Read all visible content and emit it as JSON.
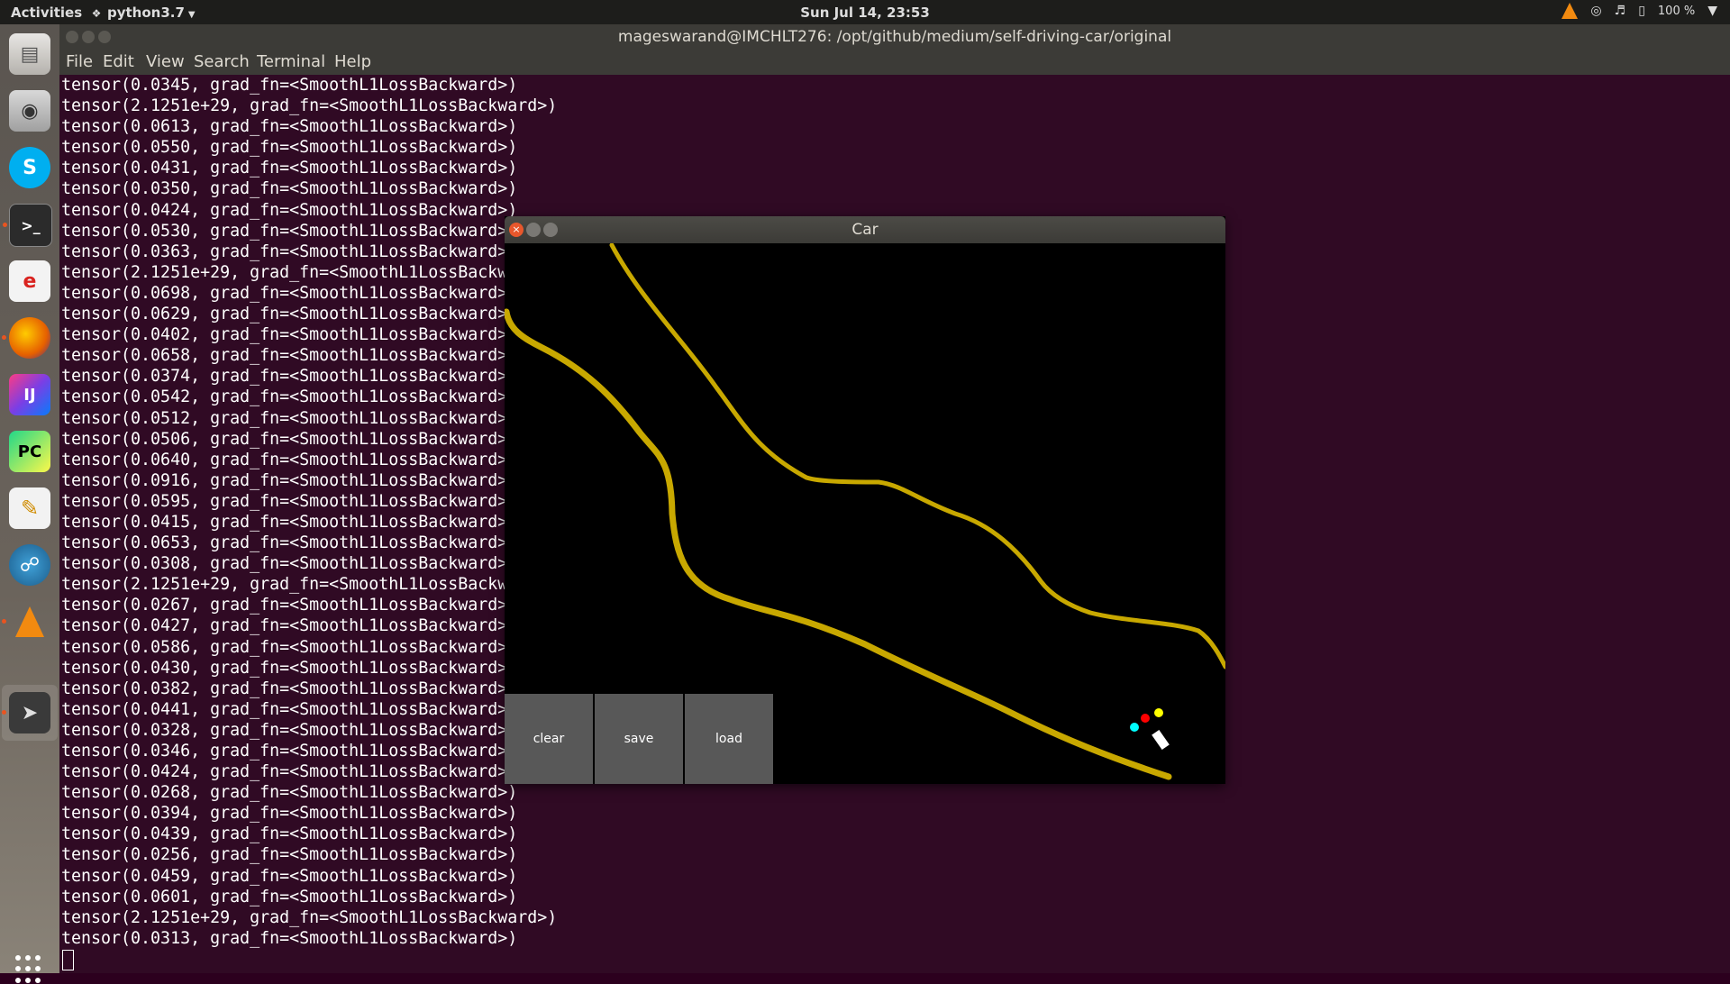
{
  "topbar": {
    "activities": "Activities",
    "app_menu": "python3.7",
    "clock": "Sun Jul 14, 23:53",
    "battery": "100 %"
  },
  "dock": {
    "items": [
      "files-icon",
      "screenshot-icon",
      "skype-icon",
      "terminal-icon",
      "ebook-reader-icon",
      "firefox-icon",
      "intellij-idea-icon",
      "pycharm-icon",
      "text-editor-icon",
      "network-globe-icon",
      "vlc-icon",
      "kivy-app-icon"
    ]
  },
  "terminal": {
    "title": "mageswarand@IMCHLT276: /opt/github/medium/self-driving-car/original",
    "menu": [
      "File",
      "Edit",
      "View",
      "Search",
      "Terminal",
      "Help"
    ],
    "lines": [
      "tensor(0.0345, grad_fn=<SmoothL1LossBackward>)",
      "tensor(2.1251e+29, grad_fn=<SmoothL1LossBackward>)",
      "tensor(0.0613, grad_fn=<SmoothL1LossBackward>)",
      "tensor(0.0550, grad_fn=<SmoothL1LossBackward>)",
      "tensor(0.0431, grad_fn=<SmoothL1LossBackward>)",
      "tensor(0.0350, grad_fn=<SmoothL1LossBackward>)",
      "tensor(0.0424, grad_fn=<SmoothL1LossBackward>)",
      "tensor(0.0530, grad_fn=<SmoothL1LossBackward>",
      "tensor(0.0363, grad_fn=<SmoothL1LossBackward>",
      "tensor(2.1251e+29, grad_fn=<SmoothL1LossBackw",
      "tensor(0.0698, grad_fn=<SmoothL1LossBackward>",
      "tensor(0.0629, grad_fn=<SmoothL1LossBackward>",
      "tensor(0.0402, grad_fn=<SmoothL1LossBackward>",
      "tensor(0.0658, grad_fn=<SmoothL1LossBackward>",
      "tensor(0.0374, grad_fn=<SmoothL1LossBackward>",
      "tensor(0.0542, grad_fn=<SmoothL1LossBackward>",
      "tensor(0.0512, grad_fn=<SmoothL1LossBackward>",
      "tensor(0.0506, grad_fn=<SmoothL1LossBackward>",
      "tensor(0.0640, grad_fn=<SmoothL1LossBackward>",
      "tensor(0.0916, grad_fn=<SmoothL1LossBackward>",
      "tensor(0.0595, grad_fn=<SmoothL1LossBackward>",
      "tensor(0.0415, grad_fn=<SmoothL1LossBackward>",
      "tensor(0.0653, grad_fn=<SmoothL1LossBackward>",
      "tensor(0.0308, grad_fn=<SmoothL1LossBackward>",
      "tensor(2.1251e+29, grad_fn=<SmoothL1LossBackw",
      "tensor(0.0267, grad_fn=<SmoothL1LossBackward>",
      "tensor(0.0427, grad_fn=<SmoothL1LossBackward>",
      "tensor(0.0586, grad_fn=<SmoothL1LossBackward>",
      "tensor(0.0430, grad_fn=<SmoothL1LossBackward>",
      "tensor(0.0382, grad_fn=<SmoothL1LossBackward>",
      "tensor(0.0441, grad_fn=<SmoothL1LossBackward>",
      "tensor(0.0328, grad_fn=<SmoothL1LossBackward>",
      "tensor(0.0346, grad_fn=<SmoothL1LossBackward>",
      "tensor(0.0424, grad_fn=<SmoothL1LossBackward>",
      "tensor(0.0268, grad_fn=<SmoothL1LossBackward>)",
      "tensor(0.0394, grad_fn=<SmoothL1LossBackward>)",
      "tensor(0.0439, grad_fn=<SmoothL1LossBackward>)",
      "tensor(0.0256, grad_fn=<SmoothL1LossBackward>)",
      "tensor(0.0459, grad_fn=<SmoothL1LossBackward>)",
      "tensor(0.0601, grad_fn=<SmoothL1LossBackward>)",
      "tensor(2.1251e+29, grad_fn=<SmoothL1LossBackward>)",
      "tensor(0.0313, grad_fn=<SmoothL1LossBackward>)"
    ]
  },
  "car_window": {
    "title": "Car",
    "buttons": {
      "clear": "clear",
      "save": "save",
      "load": "load"
    },
    "colors": {
      "sand": "#c8a800",
      "sensor1": "#ff0000",
      "sensor2": "#00ffff",
      "sensor3": "#ffff00",
      "car": "#ffffff"
    }
  },
  "colors": {
    "terminal_bg": "#300a24",
    "topbar_bg": "#1d1d1b",
    "titlebar_bg": "#3c3b37"
  }
}
